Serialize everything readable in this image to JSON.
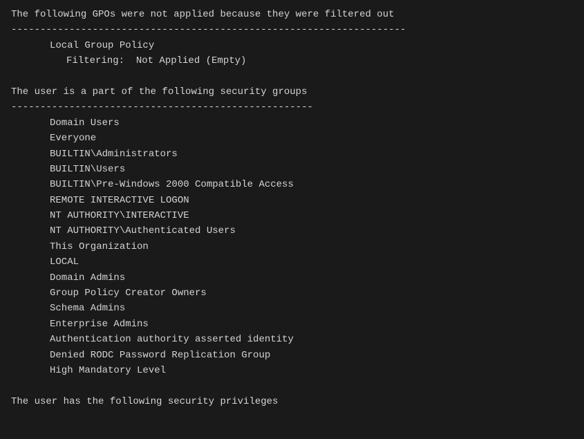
{
  "terminal": {
    "lines": [
      {
        "type": "text",
        "indent": 0,
        "content": "The following GPOs were not applied because they were filtered out"
      },
      {
        "type": "separator",
        "indent": 0,
        "content": "--------------------------------------------------------------------"
      },
      {
        "type": "text",
        "indent": 1,
        "content": "Local Group Policy"
      },
      {
        "type": "text",
        "indent": 2,
        "content": "Filtering:  Not Applied (Empty)"
      },
      {
        "type": "blank",
        "content": ""
      },
      {
        "type": "text",
        "indent": 0,
        "content": "The user is a part of the following security groups"
      },
      {
        "type": "separator",
        "indent": 0,
        "content": "----------------------------------------------------"
      },
      {
        "type": "text",
        "indent": 1,
        "content": "Domain Users"
      },
      {
        "type": "text",
        "indent": 1,
        "content": "Everyone"
      },
      {
        "type": "text",
        "indent": 1,
        "content": "BUILTIN\\Administrators"
      },
      {
        "type": "text",
        "indent": 1,
        "content": "BUILTIN\\Users"
      },
      {
        "type": "text",
        "indent": 1,
        "content": "BUILTIN\\Pre-Windows 2000 Compatible Access"
      },
      {
        "type": "text",
        "indent": 1,
        "content": "REMOTE INTERACTIVE LOGON"
      },
      {
        "type": "text",
        "indent": 1,
        "content": "NT AUTHORITY\\INTERACTIVE"
      },
      {
        "type": "text",
        "indent": 1,
        "content": "NT AUTHORITY\\Authenticated Users"
      },
      {
        "type": "text",
        "indent": 1,
        "content": "This Organization"
      },
      {
        "type": "text",
        "indent": 1,
        "content": "LOCAL"
      },
      {
        "type": "text",
        "indent": 1,
        "content": "Domain Admins"
      },
      {
        "type": "text",
        "indent": 1,
        "content": "Group Policy Creator Owners"
      },
      {
        "type": "text",
        "indent": 1,
        "content": "Schema Admins"
      },
      {
        "type": "text",
        "indent": 1,
        "content": "Enterprise Admins"
      },
      {
        "type": "text",
        "indent": 1,
        "content": "Authentication authority asserted identity"
      },
      {
        "type": "text",
        "indent": 1,
        "content": "Denied RODC Password Replication Group"
      },
      {
        "type": "text",
        "indent": 1,
        "content": "High Mandatory Level"
      },
      {
        "type": "blank",
        "content": ""
      },
      {
        "type": "text",
        "indent": 0,
        "content": "The user has the following security privileges"
      }
    ],
    "indent_sizes": [
      0,
      56,
      80
    ]
  }
}
